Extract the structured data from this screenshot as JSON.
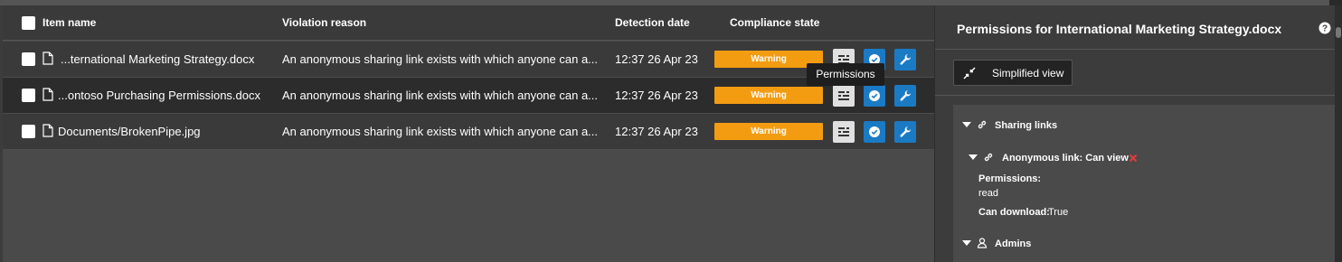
{
  "table": {
    "headers": {
      "item_name": "Item name",
      "violation_reason": "Violation reason",
      "detection_date": "Detection date",
      "compliance_state": "Compliance state"
    },
    "rows": [
      {
        "name": "...ternational Marketing Strategy.docx",
        "reason": "An anonymous sharing link exists with which anyone can a...",
        "date": "12:37 26 Apr 23",
        "state": "Warning"
      },
      {
        "name": "...ontoso Purchasing Permissions.docx",
        "reason": "An anonymous sharing link exists with which anyone can a...",
        "date": "12:37 26 Apr 23",
        "state": "Warning"
      },
      {
        "name": "Documents/BrokenPipe.jpg",
        "reason": "An anonymous sharing link exists with which anyone can a...",
        "date": "12:37 26 Apr 23",
        "state": "Warning"
      }
    ],
    "tooltip": "Permissions",
    "icons": {
      "permissions": "permissions-icon",
      "approve": "check-circle-icon",
      "remediate": "wrench-icon",
      "file": "document-icon"
    }
  },
  "panel": {
    "title": "Permissions for International Marketing Strategy.docx",
    "simplified_view_label": "Simplified view",
    "tree": {
      "sharing_links_label": "Sharing links",
      "anonymous_link_label": "Anonymous link: Can view",
      "permissions_label": "Permissions:",
      "permissions_value": "read",
      "can_download_label": "Can download:",
      "can_download_value": "True",
      "admins_label": "Admins"
    }
  },
  "colors": {
    "warning": "#f39c12",
    "action_blue": "#1b7ac4",
    "remove_red": "#e03a3a",
    "background": "#4a4a4a"
  }
}
